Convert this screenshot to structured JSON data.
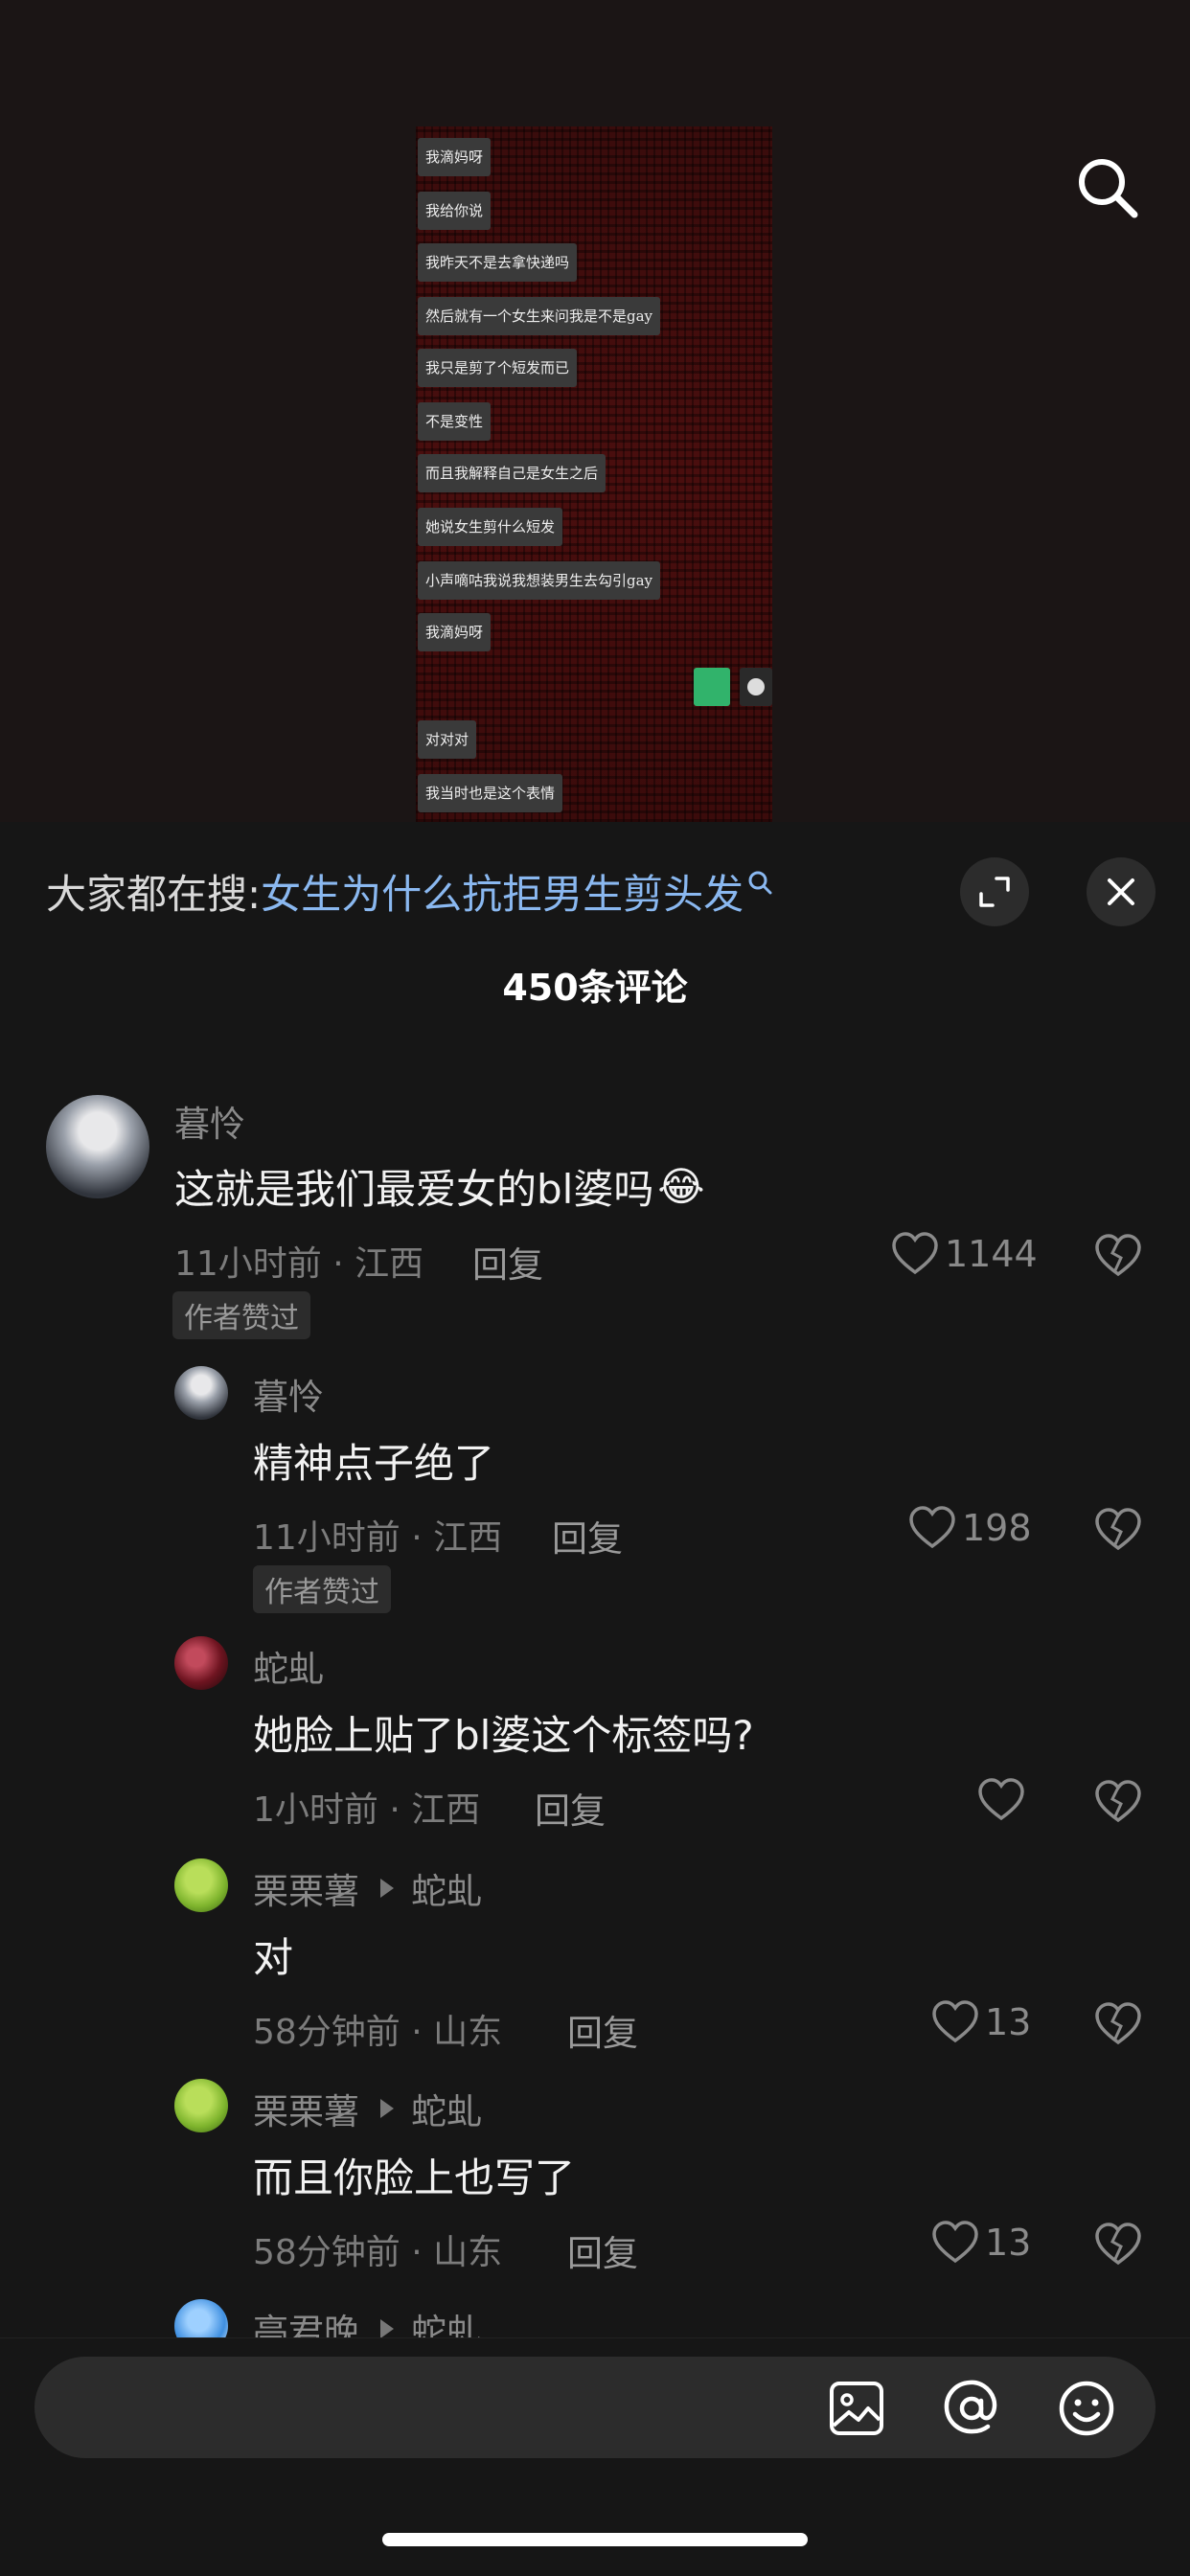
{
  "video": {
    "messages": [
      "我滴妈呀",
      "我给你说",
      "我昨天不是去拿快递吗",
      "然后就有一个女生来问我是不是gay",
      "我只是剪了个短发而已",
      "不是变性",
      "而且我解释自己是女生之后",
      "她说女生剪什么短发",
      "小声嘀咕我说我想装男生去勾引gay",
      "我滴妈呀",
      "对对对",
      "我当时也是这个表情"
    ]
  },
  "search": {
    "label": "大家都在搜:",
    "query": "女生为什么抗拒男生剪头发"
  },
  "comments_count": "450条评论",
  "comments": [
    {
      "user": "暮怜",
      "text": "这就是我们最爱女的bl婆吗",
      "emoji": "😂",
      "time": "11小时前 · 江西",
      "reply": "回复",
      "likes": "1144",
      "badge": "作者赞过"
    },
    {
      "user": "暮怜",
      "text": "精神点子绝了",
      "time": "11小时前 · 江西",
      "reply": "回复",
      "likes": "198",
      "badge": "作者赞过"
    },
    {
      "user": "蛇虬",
      "text": "她脸上贴了bl婆这个标签吗?",
      "time": "1小时前 · 江西",
      "reply": "回复",
      "likes": ""
    },
    {
      "user": "栗栗薯",
      "reply_to": "蛇虬",
      "text": "对",
      "time": "58分钟前 · 山东",
      "reply": "回复",
      "likes": "13"
    },
    {
      "user": "栗栗薯",
      "reply_to": "蛇虬",
      "text": "而且你脸上也写了",
      "time": "58分钟前 · 山东",
      "reply": "回复",
      "likes": "13"
    },
    {
      "user": "亭君晚",
      "reply_to": "蛇虬"
    }
  ],
  "input": {
    "placeholder": ""
  },
  "icons": [
    "search-icon",
    "expand-icon",
    "close-icon",
    "heart-icon",
    "broken-heart-icon",
    "image-icon",
    "at-icon",
    "emoji-icon"
  ]
}
